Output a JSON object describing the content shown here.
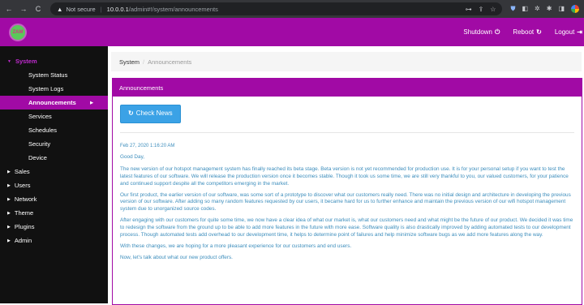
{
  "browser": {
    "back": "←",
    "forward": "→",
    "reload": "C",
    "not_secure": "Not secure",
    "host": "10.0.0.1",
    "path": "/admin#!/system/announcements"
  },
  "header": {
    "logo_text": "ZAM",
    "shutdown": "Shutdown",
    "reboot": "Reboot",
    "logout": "Logout"
  },
  "sidebar": {
    "system_label": "System",
    "system_items": [
      "System Status",
      "System Logs",
      "Announcements",
      "Services",
      "Schedules",
      "Security",
      "Device"
    ],
    "sections": [
      "Sales",
      "Users",
      "Network",
      "Theme",
      "Plugins",
      "Admin"
    ]
  },
  "breadcrumb": {
    "root": "System",
    "current": "Announcements"
  },
  "panel": {
    "title": "Announcements",
    "check_news": "Check News"
  },
  "news": {
    "date": "Feb 27, 2020 1:16:20 AM",
    "greeting": "Good Day,",
    "paragraphs": [
      "The new version of our hotspot management system has finally reached its beta stage. Beta version is not yet recommended for production use. It is for your personal setup if you want to test the latest features of our software. We will release the production version once it becomes stable. Though it took us some time, we are still very thankful to you, our valued customers, for your patience and continued support despite all the competitors emerging in the market.",
      "Our first product, the earlier version of our software, was some sort of a prototype to discover what our customers really need. There was no initial design and architecture in developing the previous version of our software. After adding so many random features requested by our users, it became hard for us to further enhance and maintain the previous version of our wifi hotspot management system due to unorganized source codes.",
      "After engaging with our customers for quite some time, we now have a clear idea of what our market is, what our customers need and what might be the future of our product. We decided it was time to redesign the software from the ground up to be able to add more features in the future with more ease. Software quality is also drastically improved by adding automated tests to our development process. Though automated tests add overhead to our development time, it helps to determine point of failures and help minimize software bugs as we add more features along the way.",
      "With these changes, we are hoping for a more pleasant experience for our customers and end users.",
      "Now, let's talk about what our new product offers."
    ]
  }
}
